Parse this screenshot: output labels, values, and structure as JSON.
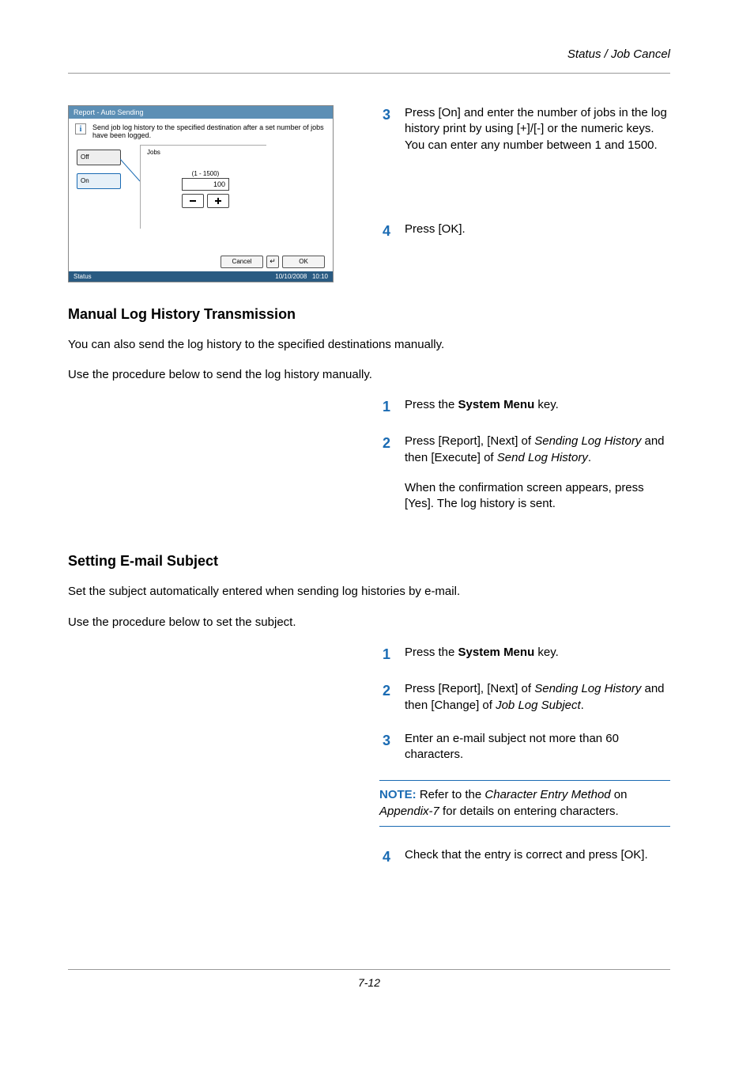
{
  "header": {
    "title": "Status / Job Cancel"
  },
  "footer": {
    "page": "7-12"
  },
  "screenshot": {
    "title": "Report - Auto Sending",
    "help": "Send job log history to the specified destination after a set number of jobs have been logged.",
    "off": "Off",
    "on": "On",
    "jobs_label": "Jobs",
    "range": "(1 - 1500)",
    "value": "100",
    "cancel": "Cancel",
    "return": "↵",
    "ok": "OK",
    "status": "Status",
    "datetime": "10/10/2008   10:10"
  },
  "top_steps": {
    "s3": "Press [On] and enter the number of jobs in the log history print by using [+]/[-] or the numeric keys. You can enter any number between 1 and 1500.",
    "s4": "Press [OK]."
  },
  "manual": {
    "heading": "Manual Log History Transmission",
    "p1": "You can also send the log history to the specified destinations manually.",
    "p2": "Use the procedure below to send the log history manually.",
    "s1a": "Press the ",
    "s1b": "System Menu",
    "s1c": " key.",
    "s2a": "Press [Report], [Next] of ",
    "s2b": "Sending Log History",
    "s2c": " and then [Execute] of ",
    "s2d": "Send Log History",
    "s2e": ".",
    "s2f": "When the confirmation screen appears, press [Yes]. The log history is sent."
  },
  "subject": {
    "heading": "Setting E-mail Subject",
    "p1": "Set the subject automatically entered when sending log histories by e-mail.",
    "p2": "Use the procedure below to set the subject.",
    "s1a": "Press the ",
    "s1b": "System Menu",
    "s1c": " key.",
    "s2a": "Press [Report], [Next] of ",
    "s2b": "Sending Log History",
    "s2c": " and then [Change] of ",
    "s2d": "Job Log Subject",
    "s2e": ".",
    "s3": "Enter an e-mail subject not more than 60 characters.",
    "note_label": "NOTE:",
    "note_a": " Refer to the ",
    "note_b": "Character Entry Method",
    "note_c": " on ",
    "note_d": "Appendix-7",
    "note_e": " for details on entering characters.",
    "s4": "Check that the entry is correct and press [OK]."
  }
}
